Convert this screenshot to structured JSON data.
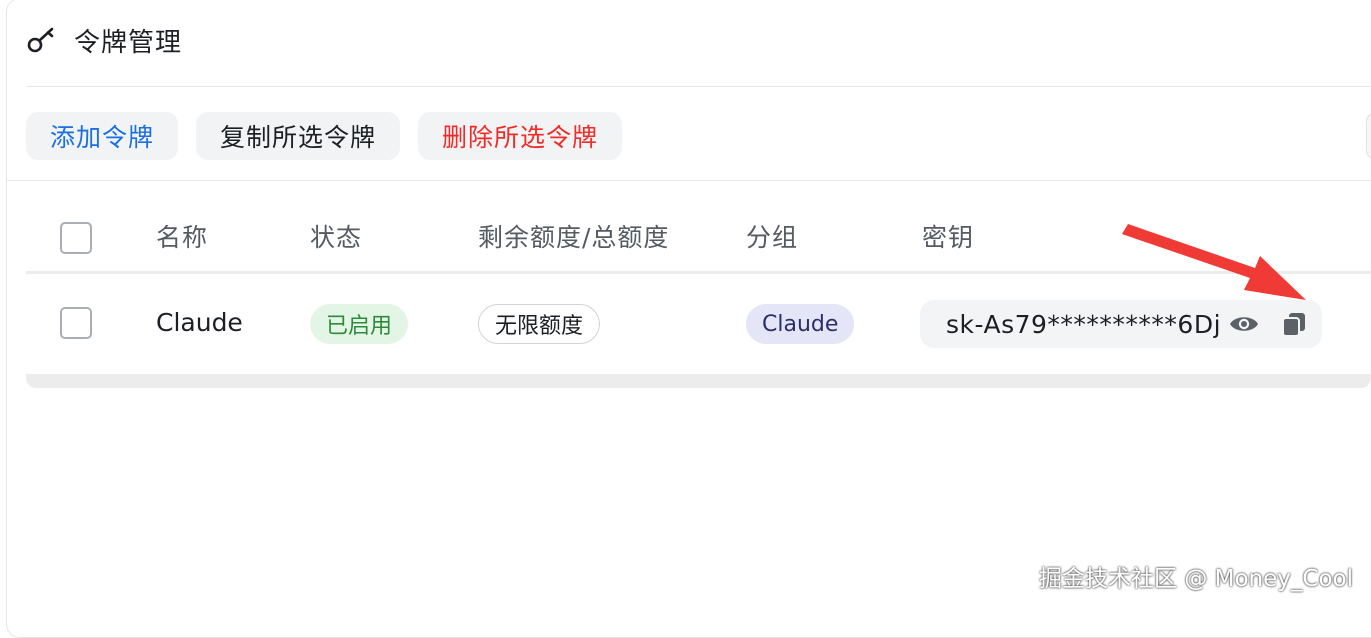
{
  "header": {
    "title": "令牌管理",
    "icon": "key-icon"
  },
  "toolbar": {
    "add_label": "添加令牌",
    "copy_label": "复制所选令牌",
    "delete_label": "删除所选令牌"
  },
  "table": {
    "columns": [
      "名称",
      "状态",
      "剩余额度/总额度",
      "分组",
      "密钥"
    ],
    "rows": [
      {
        "name": "Claude",
        "status": "已启用",
        "quota": "无限额度",
        "group": "Claude",
        "key": "sk-As79**********6Dj"
      }
    ]
  },
  "colors": {
    "accent": "#1b6fe3",
    "danger": "#ef2c28",
    "status_enabled_bg": "#e3f5e4",
    "group_tag_bg": "#e4e6f7",
    "annotation_arrow": "#f03a35"
  },
  "watermark": "掘金技术社区 @ Money_Cool"
}
